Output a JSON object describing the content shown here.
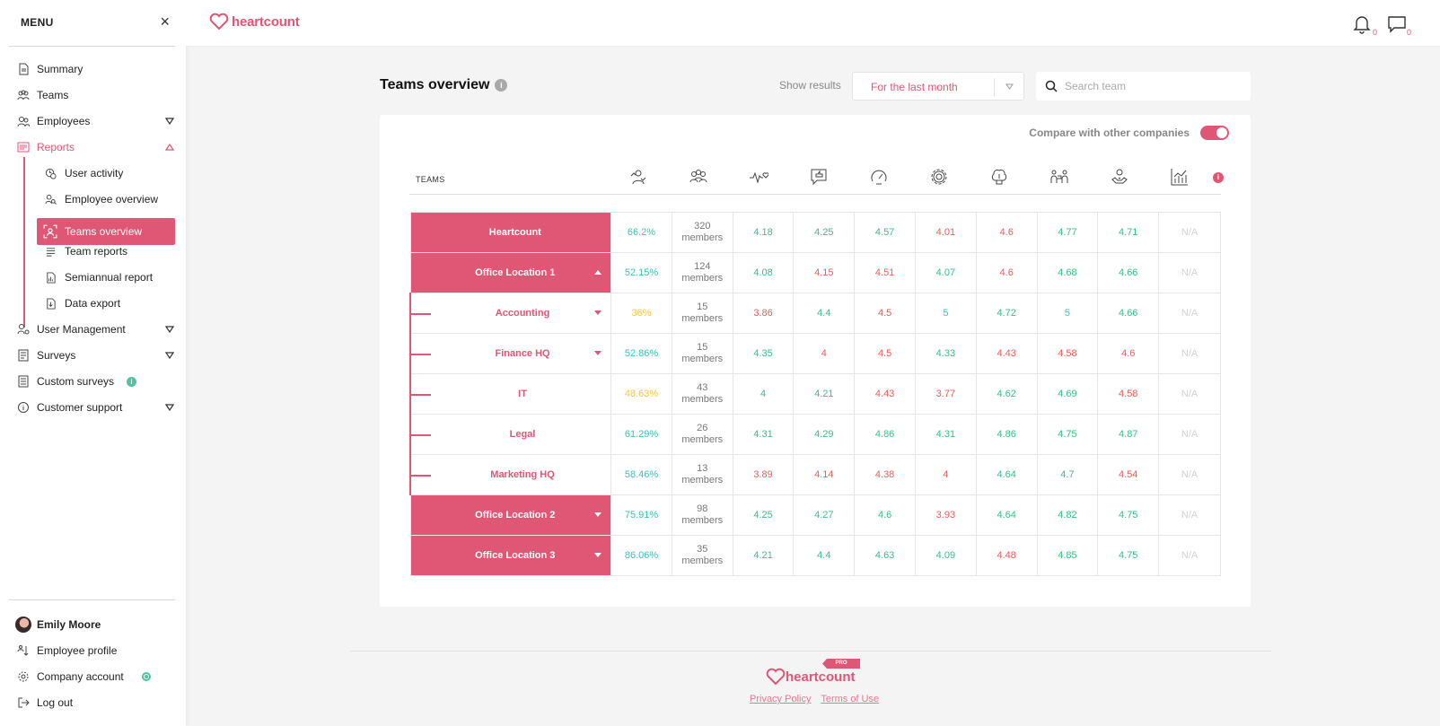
{
  "sidebar": {
    "title": "MENU",
    "close": "×",
    "items": {
      "summary": "Summary",
      "teams": "Teams",
      "employees": "Employees",
      "reports": "Reports",
      "user_activity": "User activity",
      "employee_overview": "Employee overview",
      "teams_overview": "Teams overview",
      "team_reports": "Team reports",
      "semiannual_report": "Semiannual report",
      "data_export": "Data export",
      "user_management": "User Management",
      "surveys": "Surveys",
      "custom_surveys": "Custom surveys",
      "customer_support": "Customer support"
    },
    "footer": {
      "user_name": "Emily Moore",
      "employee_profile": "Employee profile",
      "company_account": "Company account",
      "log_out": "Log out"
    }
  },
  "topbar": {
    "brand": "heartcount",
    "notifications_count": "0",
    "messages_count": "0"
  },
  "header": {
    "title": "Teams overview",
    "show_results_label": "Show results",
    "period": "For the last month",
    "search_placeholder": "Search team"
  },
  "card": {
    "compare_label": "Compare with other companies",
    "compare_on": true,
    "teams_header": "TEAMS",
    "metric_icons": [
      "engagement-icon",
      "team-members-icon",
      "heartbeat-icon",
      "feedback-icon",
      "gauge-icon",
      "settings-gear-icon",
      "brain-icon",
      "collaboration-icon",
      "wellbeing-icon",
      "growth-chart-icon"
    ]
  },
  "rows": [
    {
      "name": "Heartcount",
      "type": "top",
      "toggle": "",
      "participation": "66.2%",
      "pcolor": "t",
      "members_count": "320",
      "members_label": "members",
      "scores": [
        [
          "4.18",
          "g"
        ],
        [
          "4.25",
          "g"
        ],
        [
          "4.57",
          "g"
        ],
        [
          "4.01",
          "r"
        ],
        [
          "4.6",
          "r"
        ],
        [
          "4.77",
          "g"
        ],
        [
          "4.71",
          "g"
        ],
        [
          "N/A",
          "na"
        ]
      ]
    },
    {
      "name": "Office Location 1",
      "type": "top",
      "toggle": "up",
      "participation": "52.15%",
      "pcolor": "t",
      "members_count": "124",
      "members_label": "members",
      "scores": [
        [
          "4.08",
          "g"
        ],
        [
          "4.15",
          "r"
        ],
        [
          "4.51",
          "r"
        ],
        [
          "4.07",
          "g"
        ],
        [
          "4.6",
          "r"
        ],
        [
          "4.68",
          "g"
        ],
        [
          "4.66",
          "g"
        ],
        [
          "N/A",
          "na"
        ]
      ]
    },
    {
      "name": "Accounting",
      "type": "sub",
      "toggle": "down",
      "participation": "36%",
      "pcolor": "y",
      "members_count": "15",
      "members_label": "members",
      "scores": [
        [
          "3.86",
          "r"
        ],
        [
          "4.4",
          "g"
        ],
        [
          "4.5",
          "r"
        ],
        [
          "5",
          "t"
        ],
        [
          "4.72",
          "g"
        ],
        [
          "5",
          "t"
        ],
        [
          "4.66",
          "g"
        ],
        [
          "N/A",
          "na"
        ]
      ]
    },
    {
      "name": "Finance HQ",
      "type": "sub",
      "toggle": "down",
      "participation": "52.86%",
      "pcolor": "t",
      "members_count": "15",
      "members_label": "members",
      "scores": [
        [
          "4.35",
          "g"
        ],
        [
          "4",
          "r"
        ],
        [
          "4.5",
          "r"
        ],
        [
          "4.33",
          "g"
        ],
        [
          "4.43",
          "r"
        ],
        [
          "4.58",
          "r"
        ],
        [
          "4.6",
          "r"
        ],
        [
          "N/A",
          "na"
        ]
      ]
    },
    {
      "name": "IT",
      "type": "sub",
      "toggle": "",
      "participation": "48.63%",
      "pcolor": "y",
      "members_count": "43",
      "members_label": "members",
      "scores": [
        [
          "4",
          "g"
        ],
        [
          "4.21",
          "g"
        ],
        [
          "4.43",
          "r"
        ],
        [
          "3.77",
          "r"
        ],
        [
          "4.62",
          "g"
        ],
        [
          "4.69",
          "g"
        ],
        [
          "4.58",
          "r"
        ],
        [
          "N/A",
          "na"
        ]
      ]
    },
    {
      "name": "Legal",
      "type": "sub",
      "toggle": "",
      "participation": "61.29%",
      "pcolor": "t",
      "members_count": "26",
      "members_label": "members",
      "scores": [
        [
          "4.31",
          "g"
        ],
        [
          "4.29",
          "g"
        ],
        [
          "4.86",
          "g"
        ],
        [
          "4.31",
          "g"
        ],
        [
          "4.86",
          "g"
        ],
        [
          "4.75",
          "g"
        ],
        [
          "4.87",
          "g"
        ],
        [
          "N/A",
          "na"
        ]
      ]
    },
    {
      "name": "Marketing HQ",
      "type": "sub",
      "toggle": "",
      "participation": "58.46%",
      "pcolor": "t",
      "members_count": "13",
      "members_label": "members",
      "scores": [
        [
          "3.89",
          "r"
        ],
        [
          "4.14",
          "r"
        ],
        [
          "4.38",
          "r"
        ],
        [
          "4",
          "r"
        ],
        [
          "4.64",
          "g"
        ],
        [
          "4.7",
          "g"
        ],
        [
          "4.54",
          "r"
        ],
        [
          "N/A",
          "na"
        ]
      ]
    },
    {
      "name": "Office Location 2",
      "type": "top",
      "toggle": "down",
      "participation": "75.91%",
      "pcolor": "t",
      "members_count": "98",
      "members_label": "members",
      "scores": [
        [
          "4.25",
          "g"
        ],
        [
          "4.27",
          "g"
        ],
        [
          "4.6",
          "g"
        ],
        [
          "3.93",
          "r"
        ],
        [
          "4.64",
          "g"
        ],
        [
          "4.82",
          "g"
        ],
        [
          "4.75",
          "g"
        ],
        [
          "N/A",
          "na"
        ]
      ]
    },
    {
      "name": "Office Location 3",
      "type": "top",
      "toggle": "down",
      "participation": "86.06%",
      "pcolor": "t",
      "members_count": "35",
      "members_label": "members",
      "scores": [
        [
          "4.21",
          "g"
        ],
        [
          "4.4",
          "g"
        ],
        [
          "4.63",
          "g"
        ],
        [
          "4.09",
          "g"
        ],
        [
          "4.48",
          "r"
        ],
        [
          "4.85",
          "g"
        ],
        [
          "4.75",
          "g"
        ],
        [
          "N/A",
          "na"
        ]
      ]
    }
  ],
  "footer": {
    "brand": "heartcount",
    "badge": "PRO",
    "privacy": "Privacy Policy",
    "terms": "Terms of Use"
  },
  "colors": {
    "brand": "#e05675",
    "green": "#36bf87",
    "red": "#ef5a5a",
    "teal": "#3fc1b4",
    "yellow": "#f5c542"
  }
}
